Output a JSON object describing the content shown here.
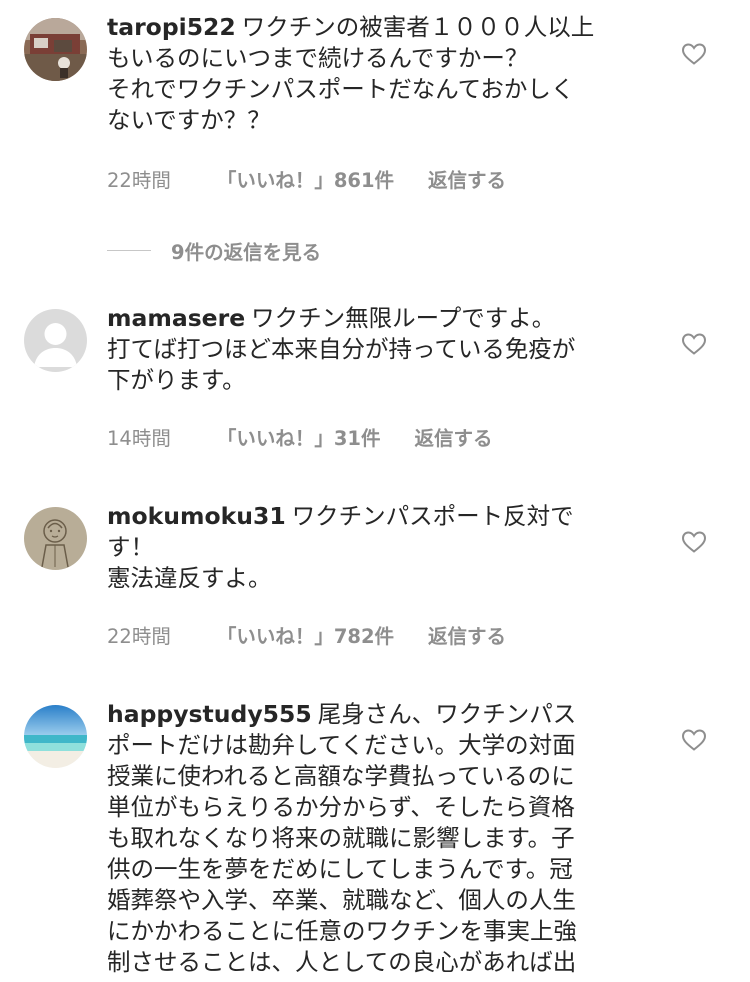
{
  "colors": {
    "primary_text": "#262626",
    "secondary_text": "#8e8e8e",
    "divider": "#c7c7c7"
  },
  "comments": [
    {
      "username": "taropi522",
      "lines": [
        "ワクチンの被害者１０００人以上",
        "もいるのにいつまで続けるんですかー？",
        "それでワクチンパスポートだなんておかしく",
        "ないですか？？"
      ],
      "time": "22時間",
      "likes": "「いいね！」861件",
      "reply": "返信する",
      "avatar_icon": "photo-avatar-icon",
      "like_icon": "heart-outline-icon"
    },
    {
      "username": "mamasere",
      "lines": [
        "ワクチン無限ループですよ。",
        "打てば打つほど本来自分が持っている免疫が",
        "下がります。"
      ],
      "time": "14時間",
      "likes": "「いいね！」31件",
      "reply": "返信する",
      "avatar_icon": "default-avatar-icon",
      "like_icon": "heart-outline-icon"
    },
    {
      "username": "mokumoku31",
      "lines": [
        "ワクチンパスポート反対で",
        "す！",
        "憲法違反すよ。"
      ],
      "time": "22時間",
      "likes": "「いいね！」782件",
      "reply": "返信する",
      "avatar_icon": "drawing-avatar-icon",
      "like_icon": "heart-outline-icon"
    },
    {
      "username": "happystudy555",
      "lines": [
        "尾身さん、ワクチンパス",
        "ポートだけは勘弁してください。大学の対面",
        "授業に使われると高額な学費払っているのに",
        "単位がもらえりるか分からず、そしたら資格",
        "も取れなくなり将来の就職に影響します。子",
        "供の一生を夢をだめにしてしまうんです。冠",
        "婚葬祭や入学、卒業、就職など、個人の人生",
        "にかかわることに任意のワクチンを事実上強",
        "制させることは、人としての良心があれば出"
      ],
      "avatar_icon": "beach-avatar-icon",
      "like_icon": "heart-outline-icon"
    }
  ],
  "view_replies": {
    "label": "9件の返信を見る"
  }
}
